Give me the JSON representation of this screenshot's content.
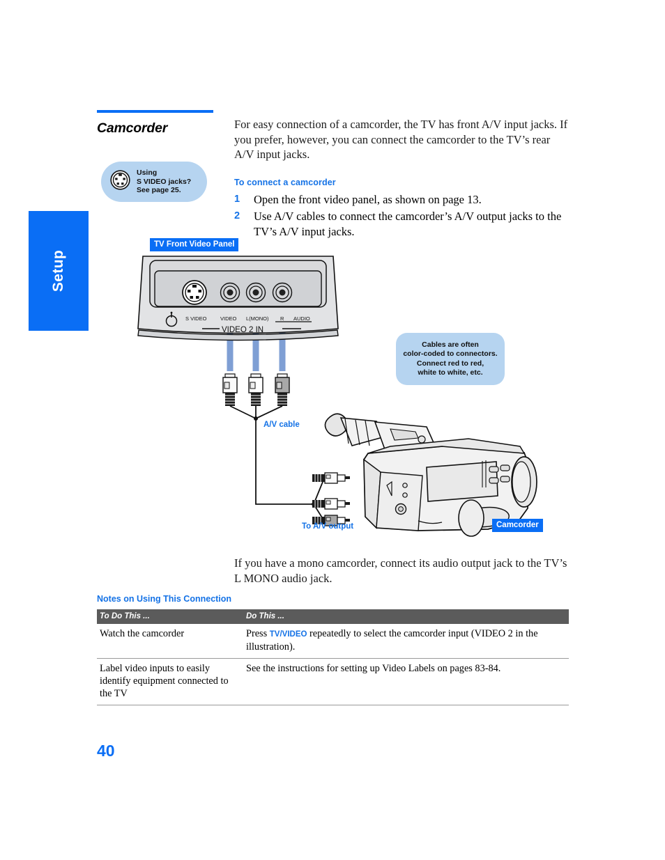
{
  "sidebar": {
    "tab_label": "Setup"
  },
  "section": {
    "title": "Camcorder",
    "rule_color": "#0a6ef5"
  },
  "svideo_tip": {
    "icon": "s-video-connector-icon",
    "line1": "Using",
    "line2": "S VIDEO jacks?",
    "line3": "See page 25."
  },
  "intro": {
    "paragraph": "For easy connection of a camcorder, the TV has front A/V input jacks. If you prefer, however, you can connect the camcorder to the TV’s rear A/V input jacks."
  },
  "procedure": {
    "subhead": "To connect a camcorder",
    "steps": [
      {
        "num": "1",
        "text": "Open the front video panel, as shown on page 13."
      },
      {
        "num": "2",
        "text": "Use A/V cables to connect the camcorder’s A/V output jacks to the TV’s A/V input jacks."
      }
    ]
  },
  "figure": {
    "tv_panel_badge": "TV Front Video Panel",
    "camcorder_badge": "Camcorder",
    "panel_labels": {
      "power": "",
      "s_video": "S VIDEO",
      "video": "VIDEO",
      "l_mono": "L(MONO)",
      "r": "R",
      "audio": "AUDIO",
      "input_group": "VIDEO 2 IN"
    },
    "av_cable_label": "A/V cable",
    "to_av_output_label": "To A/V output"
  },
  "cable_tip": {
    "line1": "Cables are often",
    "line2": "color-coded to connectors.",
    "line3": "Connect red to red,",
    "line4": "white to white, etc."
  },
  "closing": {
    "paragraph": "If you have a mono camcorder, connect its audio output jack to the TV’s L MONO audio jack."
  },
  "notes": {
    "heading": "Notes on Using This Connection",
    "columns": [
      "To Do This ...",
      "Do This ..."
    ],
    "rows": [
      {
        "to_do": "Watch the camcorder",
        "do_pre": "Press ",
        "do_kw": "TV/VIDEO",
        "do_post": " repeatedly to select the camcorder input (VIDEO 2 in the illustration)."
      },
      {
        "to_do": "Label video inputs to easily identify equipment connected to the TV",
        "do_pre": "See the instructions for setting up Video Labels on pages 83-84.",
        "do_kw": "",
        "do_post": ""
      }
    ]
  },
  "page": {
    "number": "40"
  },
  "colors": {
    "accent_blue": "#0a6ef5",
    "link_blue": "#1472e6",
    "tip_bg": "#b6d4f0",
    "table_header_bg": "#5b5b5b",
    "cable_blue": "#7f9fd4"
  }
}
